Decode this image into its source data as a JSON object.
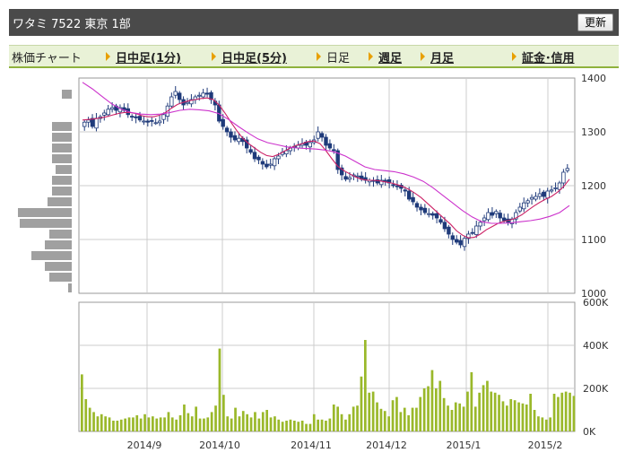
{
  "header": {
    "title": "ワタミ  7522  東京 1部",
    "refresh_label": "更新"
  },
  "tabs": [
    {
      "label": "株価チャート",
      "link": false,
      "arrow": false
    },
    {
      "label": "日中足(1分)",
      "link": true,
      "arrow": true
    },
    {
      "label": "日中足(5分)",
      "link": true,
      "arrow": true
    },
    {
      "label": "日足",
      "link": false,
      "arrow": true
    },
    {
      "label": "週足",
      "link": true,
      "arrow": true
    },
    {
      "label": "月足",
      "link": true,
      "arrow": true
    },
    {
      "label": "証金･信用",
      "link": true,
      "arrow": true
    }
  ],
  "colors": {
    "up_candle": "#ffffff",
    "down_candle": "#1f3a7a",
    "ma_short": "#cc2266",
    "ma_long": "#cc33cc",
    "volume": "#9ab82a",
    "volume_profile": "#a0a0a0",
    "grid": "#cccccc"
  },
  "chart_data": [
    {
      "type": "candlestick",
      "ylim": [
        1000,
        1400
      ],
      "y_ticks": [
        "1400",
        "1300",
        "1200",
        "1100",
        "1000"
      ],
      "x_ticks": [
        "2014/9",
        "2014/10",
        "2014/11",
        "2014/12",
        "2015/1",
        "2015/2"
      ],
      "close": [
        1318,
        1322,
        1310,
        1325,
        1328,
        1335,
        1342,
        1345,
        1340,
        1345,
        1340,
        1332,
        1328,
        1326,
        1322,
        1320,
        1318,
        1320,
        1317,
        1320,
        1332,
        1348,
        1365,
        1375,
        1360,
        1350,
        1355,
        1360,
        1365,
        1368,
        1372,
        1370,
        1360,
        1350,
        1320,
        1310,
        1300,
        1290,
        1285,
        1288,
        1282,
        1270,
        1262,
        1250,
        1248,
        1240,
        1235,
        1240,
        1250,
        1255,
        1262,
        1265,
        1270,
        1273,
        1275,
        1278,
        1275,
        1280,
        1285,
        1300,
        1290,
        1275,
        1270,
        1265,
        1230,
        1220,
        1212,
        1215,
        1220,
        1218,
        1212,
        1210,
        1210,
        1208,
        1205,
        1210,
        1208,
        1205,
        1200,
        1198,
        1195,
        1190,
        1175,
        1170,
        1160,
        1155,
        1150,
        1148,
        1145,
        1140,
        1132,
        1120,
        1110,
        1100,
        1095,
        1090,
        1102,
        1110,
        1112,
        1125,
        1132,
        1140,
        1150,
        1145,
        1152,
        1140,
        1135,
        1132,
        1138,
        1150,
        1160,
        1168,
        1172,
        1178,
        1180,
        1185,
        1180,
        1190,
        1192,
        1196,
        1205,
        1225,
        1232
      ],
      "ma_short": [
        1322,
        1323,
        1324,
        1326,
        1328,
        1331,
        1334,
        1336,
        1336,
        1334,
        1330,
        1328,
        1328,
        1331,
        1336,
        1344,
        1351,
        1355,
        1358,
        1360,
        1362,
        1363,
        1360,
        1350,
        1335,
        1318,
        1302,
        1288,
        1278,
        1270,
        1262,
        1256,
        1254,
        1258,
        1264,
        1270,
        1275,
        1278,
        1282,
        1283,
        1278,
        1265,
        1250,
        1236,
        1228,
        1222,
        1216,
        1212,
        1210,
        1210,
        1209,
        1207,
        1205,
        1202,
        1198,
        1193,
        1186,
        1178,
        1168,
        1158,
        1148,
        1138,
        1128,
        1116,
        1108,
        1103,
        1104,
        1110,
        1118,
        1124,
        1130,
        1134,
        1136,
        1140,
        1146,
        1154,
        1162,
        1169,
        1175,
        1180,
        1188,
        1198,
        1212
      ],
      "ma_long": [
        1392,
        1380,
        1366,
        1352,
        1342,
        1336,
        1333,
        1332,
        1333,
        1336,
        1340,
        1342,
        1341,
        1339,
        1334,
        1323,
        1310,
        1298,
        1287,
        1280,
        1276,
        1272,
        1270,
        1269,
        1268,
        1266,
        1262,
        1255,
        1245,
        1235,
        1230,
        1228,
        1226,
        1222,
        1216,
        1208,
        1196,
        1182,
        1168,
        1154,
        1142,
        1133,
        1130,
        1130,
        1131,
        1133,
        1135,
        1138,
        1143,
        1150,
        1163
      ]
    },
    {
      "type": "bar",
      "ylim": [
        0,
        600000
      ],
      "y_ticks": [
        "600K",
        "400K",
        "200K",
        "0K"
      ],
      "values": [
        265,
        150,
        110,
        90,
        70,
        80,
        70,
        65,
        50,
        50,
        55,
        60,
        65,
        65,
        75,
        60,
        80,
        65,
        70,
        60,
        65,
        65,
        90,
        65,
        55,
        75,
        125,
        85,
        70,
        115,
        60,
        60,
        65,
        90,
        120,
        385,
        170,
        70,
        60,
        110,
        70,
        95,
        80,
        65,
        90,
        60,
        90,
        100,
        65,
        70,
        55,
        45,
        50,
        55,
        50,
        45,
        50,
        35,
        35,
        80,
        55,
        55,
        50,
        60,
        125,
        115,
        80,
        55,
        80,
        115,
        120,
        255,
        425,
        180,
        185,
        135,
        105,
        95,
        70,
        145,
        160,
        90,
        110,
        75,
        110,
        110,
        160,
        200,
        210,
        285,
        200,
        235,
        155,
        120,
        100,
        135,
        130,
        115,
        185,
        275,
        115,
        180,
        215,
        235,
        185,
        180,
        170,
        140,
        120,
        150,
        145,
        135,
        130,
        125,
        175,
        100,
        70,
        65,
        55,
        65,
        175,
        160,
        180,
        185,
        180,
        165
      ]
    },
    {
      "type": "bar",
      "orientation": "horizontal",
      "values": [
        0,
        11,
        0,
        0,
        22,
        22,
        22,
        22,
        18,
        22,
        22,
        27,
        60,
        58,
        25,
        30,
        45,
        30,
        25,
        4
      ]
    }
  ]
}
